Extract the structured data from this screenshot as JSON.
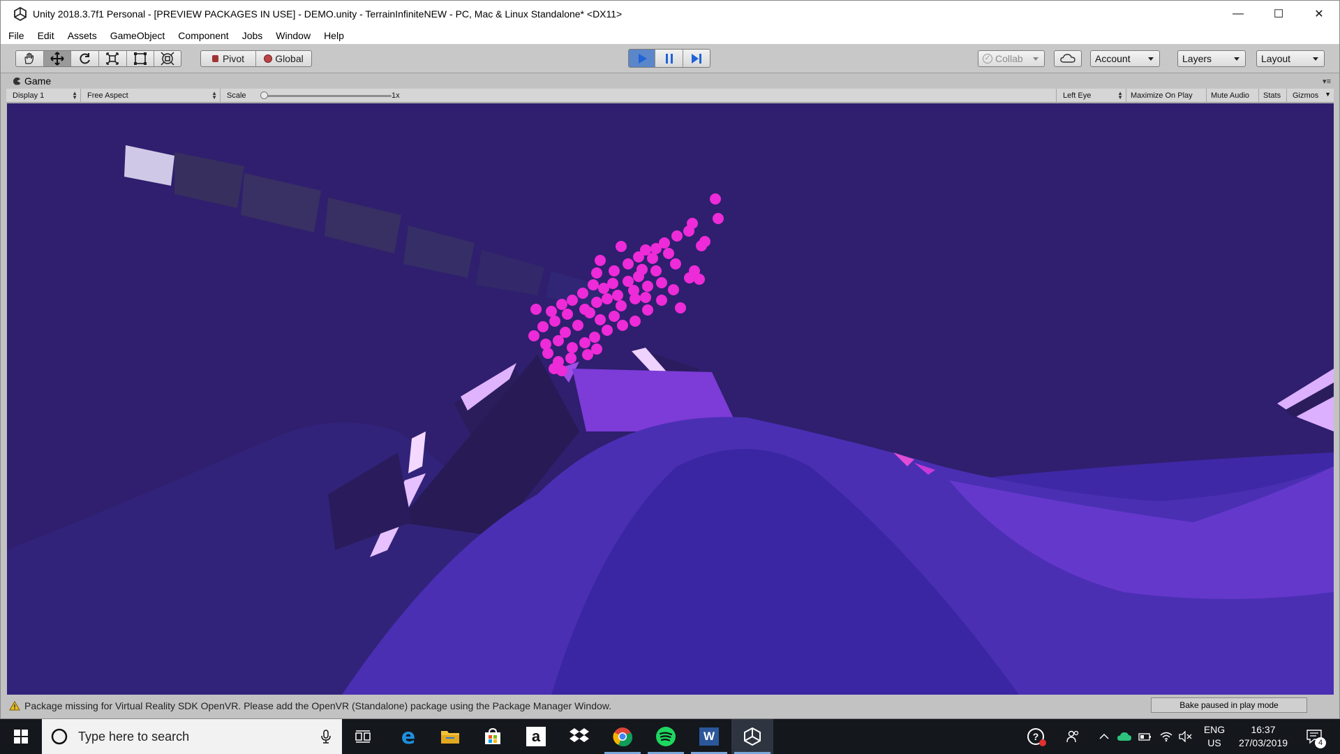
{
  "window": {
    "title": "Unity 2018.3.7f1 Personal - [PREVIEW PACKAGES IN USE] - DEMO.unity - TerrainInfiniteNEW - PC, Mac & Linux Standalone* <DX11>",
    "controls": [
      "minimize-icon",
      "maximize-icon",
      "close-icon"
    ]
  },
  "menu": [
    "File",
    "Edit",
    "Assets",
    "GameObject",
    "Component",
    "Jobs",
    "Window",
    "Help"
  ],
  "toolbar": {
    "tools": [
      "hand-icon",
      "move-icon",
      "rotate-icon",
      "scale-icon",
      "rect-icon",
      "transform-icon"
    ],
    "pivot_label": "Pivot",
    "global_label": "Global",
    "collab_label": "Collab",
    "account_label": "Account",
    "layers_label": "Layers",
    "layout_label": "Layout",
    "colors": {
      "play_active": "#5b86c9",
      "icon_blue": "#1f63d6"
    }
  },
  "game": {
    "tab_label": "Game",
    "display": "Display 1",
    "aspect": "Free Aspect",
    "scale_label": "Scale",
    "scale_value": "1x",
    "eye": "Left Eye",
    "maximize": "Maximize On Play",
    "mute": "Mute Audio",
    "stats": "Stats",
    "gizmos": "Gizmos",
    "colors": {
      "sky": "#2f1f6e",
      "particles": "#ee2bd8",
      "terrain": "#4a2fb3"
    }
  },
  "status": {
    "message": "Package missing for Virtual Reality SDK OpenVR. Please add the OpenVR (Standalone) package using the Package Manager Window.",
    "bake": "Bake paused in play mode"
  },
  "taskbar": {
    "search_placeholder": "Type here to search",
    "apps": [
      "start-icon",
      "cortana-icon",
      "mic-icon",
      "task-view-icon",
      "edge-icon",
      "file-explorer-icon",
      "store-icon",
      "amazon-icon",
      "dropbox-icon",
      "chrome-icon",
      "spotify-icon",
      "word-icon",
      "unity-icon"
    ],
    "lang_top": "ENG",
    "lang_bottom": "US",
    "time": "16:37",
    "date": "27/03/2019",
    "notifications": "4"
  }
}
